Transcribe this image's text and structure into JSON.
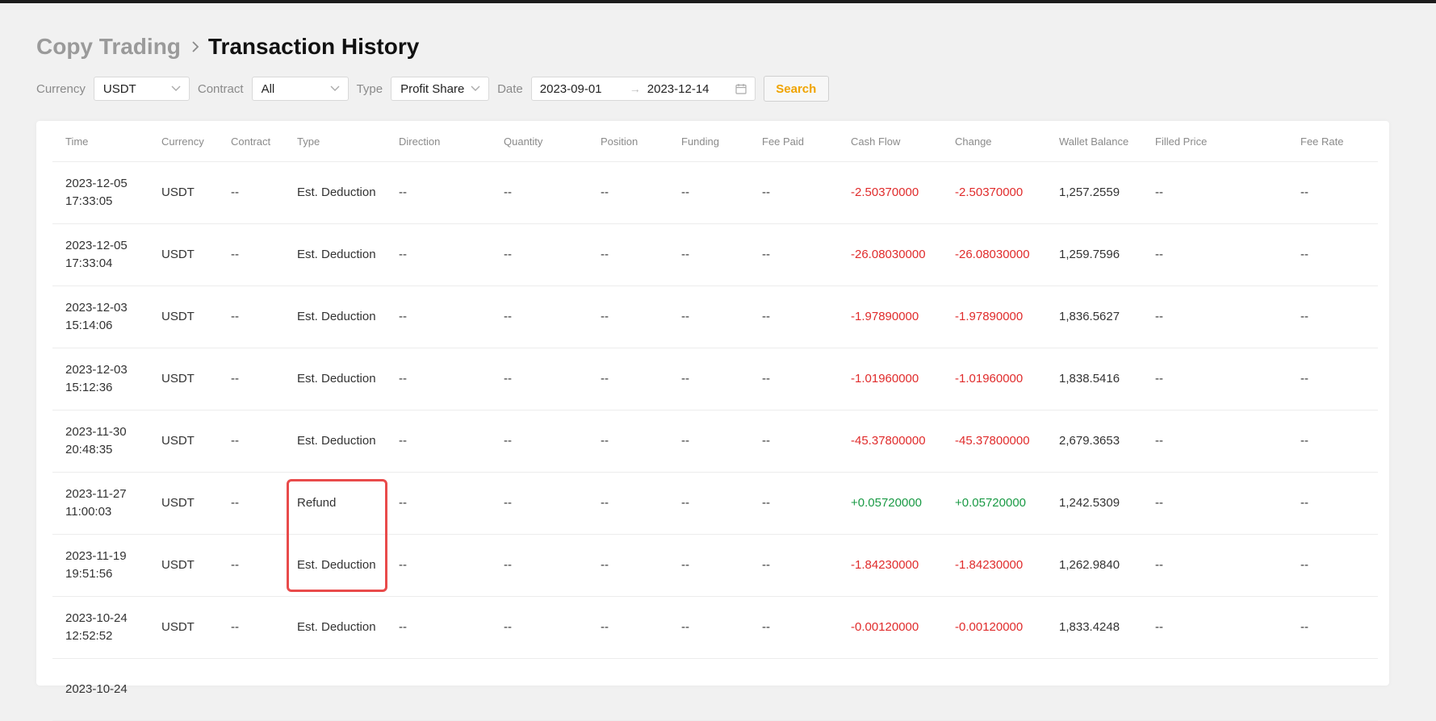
{
  "header": {
    "parent": "Copy Trading",
    "title": "Transaction History"
  },
  "filters": {
    "currency_label": "Currency",
    "currency_value": "USDT",
    "contract_label": "Contract",
    "contract_value": "All",
    "type_label": "Type",
    "type_value": "Profit Share",
    "date_label": "Date",
    "date_start": "2023-09-01",
    "date_end": "2023-12-14",
    "search_label": "Search"
  },
  "table": {
    "columns": [
      "Time",
      "Currency",
      "Contract",
      "Type",
      "Direction",
      "Quantity",
      "Position",
      "Funding",
      "Fee Paid",
      "Cash Flow",
      "Change",
      "Wallet Balance",
      "Filled Price",
      "Fee Rate"
    ],
    "rows": [
      {
        "date": "2023-12-05",
        "clock": "17:33:05",
        "currency": "USDT",
        "contract": "--",
        "type": "Est. Deduction",
        "direction": "--",
        "quantity": "--",
        "position": "--",
        "funding": "--",
        "fee_paid": "--",
        "cash_flow": "-2.50370000",
        "change": "-2.50370000",
        "wallet_balance": "1,257.2559",
        "filled_price": "--",
        "fee_rate": "--"
      },
      {
        "date": "2023-12-05",
        "clock": "17:33:04",
        "currency": "USDT",
        "contract": "--",
        "type": "Est. Deduction",
        "direction": "--",
        "quantity": "--",
        "position": "--",
        "funding": "--",
        "fee_paid": "--",
        "cash_flow": "-26.08030000",
        "change": "-26.08030000",
        "wallet_balance": "1,259.7596",
        "filled_price": "--",
        "fee_rate": "--"
      },
      {
        "date": "2023-12-03",
        "clock": "15:14:06",
        "currency": "USDT",
        "contract": "--",
        "type": "Est. Deduction",
        "direction": "--",
        "quantity": "--",
        "position": "--",
        "funding": "--",
        "fee_paid": "--",
        "cash_flow": "-1.97890000",
        "change": "-1.97890000",
        "wallet_balance": "1,836.5627",
        "filled_price": "--",
        "fee_rate": "--"
      },
      {
        "date": "2023-12-03",
        "clock": "15:12:36",
        "currency": "USDT",
        "contract": "--",
        "type": "Est. Deduction",
        "direction": "--",
        "quantity": "--",
        "position": "--",
        "funding": "--",
        "fee_paid": "--",
        "cash_flow": "-1.01960000",
        "change": "-1.01960000",
        "wallet_balance": "1,838.5416",
        "filled_price": "--",
        "fee_rate": "--"
      },
      {
        "date": "2023-11-30",
        "clock": "20:48:35",
        "currency": "USDT",
        "contract": "--",
        "type": "Est. Deduction",
        "direction": "--",
        "quantity": "--",
        "position": "--",
        "funding": "--",
        "fee_paid": "--",
        "cash_flow": "-45.37800000",
        "change": "-45.37800000",
        "wallet_balance": "2,679.3653",
        "filled_price": "--",
        "fee_rate": "--"
      },
      {
        "date": "2023-11-27",
        "clock": "11:00:03",
        "currency": "USDT",
        "contract": "--",
        "type": "Refund",
        "direction": "--",
        "quantity": "--",
        "position": "--",
        "funding": "--",
        "fee_paid": "--",
        "cash_flow": "+0.05720000",
        "change": "+0.05720000",
        "wallet_balance": "1,242.5309",
        "filled_price": "--",
        "fee_rate": "--"
      },
      {
        "date": "2023-11-19",
        "clock": "19:51:56",
        "currency": "USDT",
        "contract": "--",
        "type": "Est. Deduction",
        "direction": "--",
        "quantity": "--",
        "position": "--",
        "funding": "--",
        "fee_paid": "--",
        "cash_flow": "-1.84230000",
        "change": "-1.84230000",
        "wallet_balance": "1,262.9840",
        "filled_price": "--",
        "fee_rate": "--"
      },
      {
        "date": "2023-10-24",
        "clock": "12:52:52",
        "currency": "USDT",
        "contract": "--",
        "type": "Est. Deduction",
        "direction": "--",
        "quantity": "--",
        "position": "--",
        "funding": "--",
        "fee_paid": "--",
        "cash_flow": "-0.00120000",
        "change": "-0.00120000",
        "wallet_balance": "1,833.4248",
        "filled_price": "--",
        "fee_rate": "--"
      },
      {
        "date": "2023-10-24",
        "clock": "",
        "currency": "",
        "contract": "",
        "type": "",
        "direction": "",
        "quantity": "",
        "position": "",
        "funding": "",
        "fee_paid": "",
        "cash_flow": "",
        "change": "",
        "wallet_balance": "",
        "filled_price": "",
        "fee_rate": ""
      }
    ]
  },
  "colors": {
    "negative": "#e02b2b",
    "positive": "#1a9a45",
    "accent": "#f0a300",
    "highlight": "#e94b4b"
  }
}
